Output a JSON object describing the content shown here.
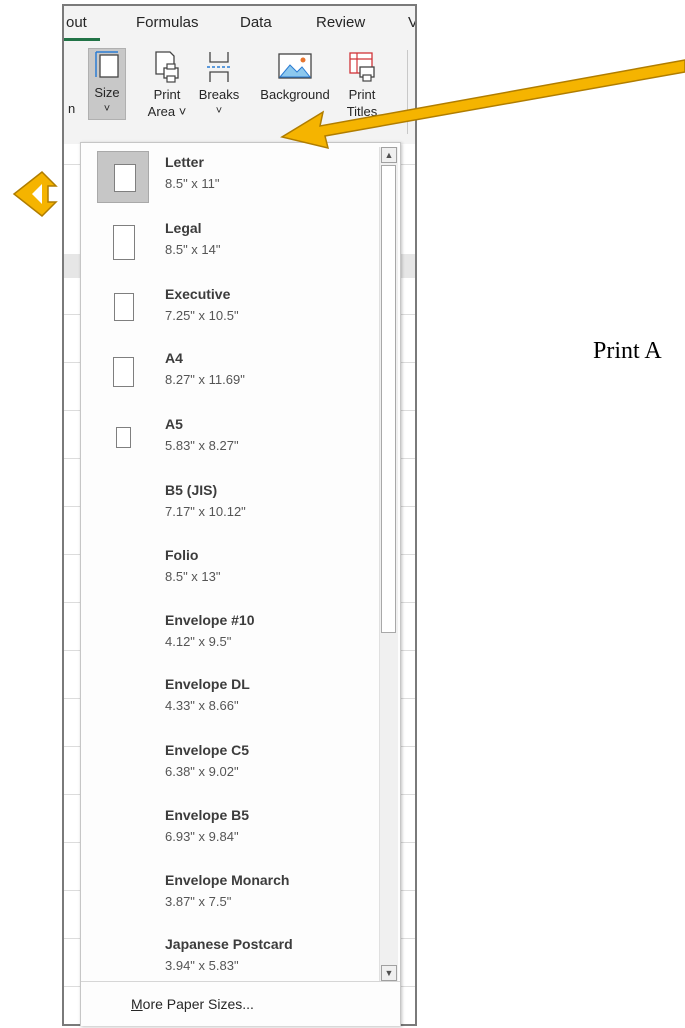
{
  "tabs": [
    {
      "label": "out"
    },
    {
      "label": "Formulas"
    },
    {
      "label": "Data"
    },
    {
      "label": "Review"
    },
    {
      "label": "V"
    }
  ],
  "ribbon": {
    "clipped_left": "n",
    "size": {
      "label": "Size",
      "chevron": "˅"
    },
    "print_area": {
      "line1": "Print",
      "line2": "Area ˅"
    },
    "breaks": {
      "label": "Breaks",
      "chevron": "˅"
    },
    "background": {
      "label": "Background"
    },
    "print_titles": {
      "line1": "Print",
      "line2": "Titles"
    }
  },
  "paper_sizes": [
    {
      "name": "Letter",
      "size": "8.5\" x 11\"",
      "selected": true
    },
    {
      "name": "Legal",
      "size": "8.5\" x 14\""
    },
    {
      "name": "Executive",
      "size": "7.25\" x 10.5\""
    },
    {
      "name": "A4",
      "size": "8.27\" x 11.69\""
    },
    {
      "name": "A5",
      "size": "5.83\" x 8.27\""
    },
    {
      "name": "B5 (JIS)",
      "size": "7.17\" x 10.12\""
    },
    {
      "name": "Folio",
      "size": "8.5\" x 13\""
    },
    {
      "name": "Envelope #10",
      "size": "4.12\" x 9.5\""
    },
    {
      "name": "Envelope DL",
      "size": "4.33\" x 8.66\""
    },
    {
      "name": "Envelope C5",
      "size": "6.38\" x 9.02\""
    },
    {
      "name": "Envelope B5",
      "size": "6.93\" x 9.84\""
    },
    {
      "name": "Envelope Monarch",
      "size": "3.87\" x 7.5\""
    },
    {
      "name": "Japanese Postcard",
      "size": "3.94\" x 5.83\""
    }
  ],
  "more_paper_sizes": "More Paper Sizes...",
  "annotation_text": "Print A",
  "colors": {
    "accent": "#217346",
    "arrow": "#f5b400",
    "arrow_outline": "#b07d00"
  }
}
